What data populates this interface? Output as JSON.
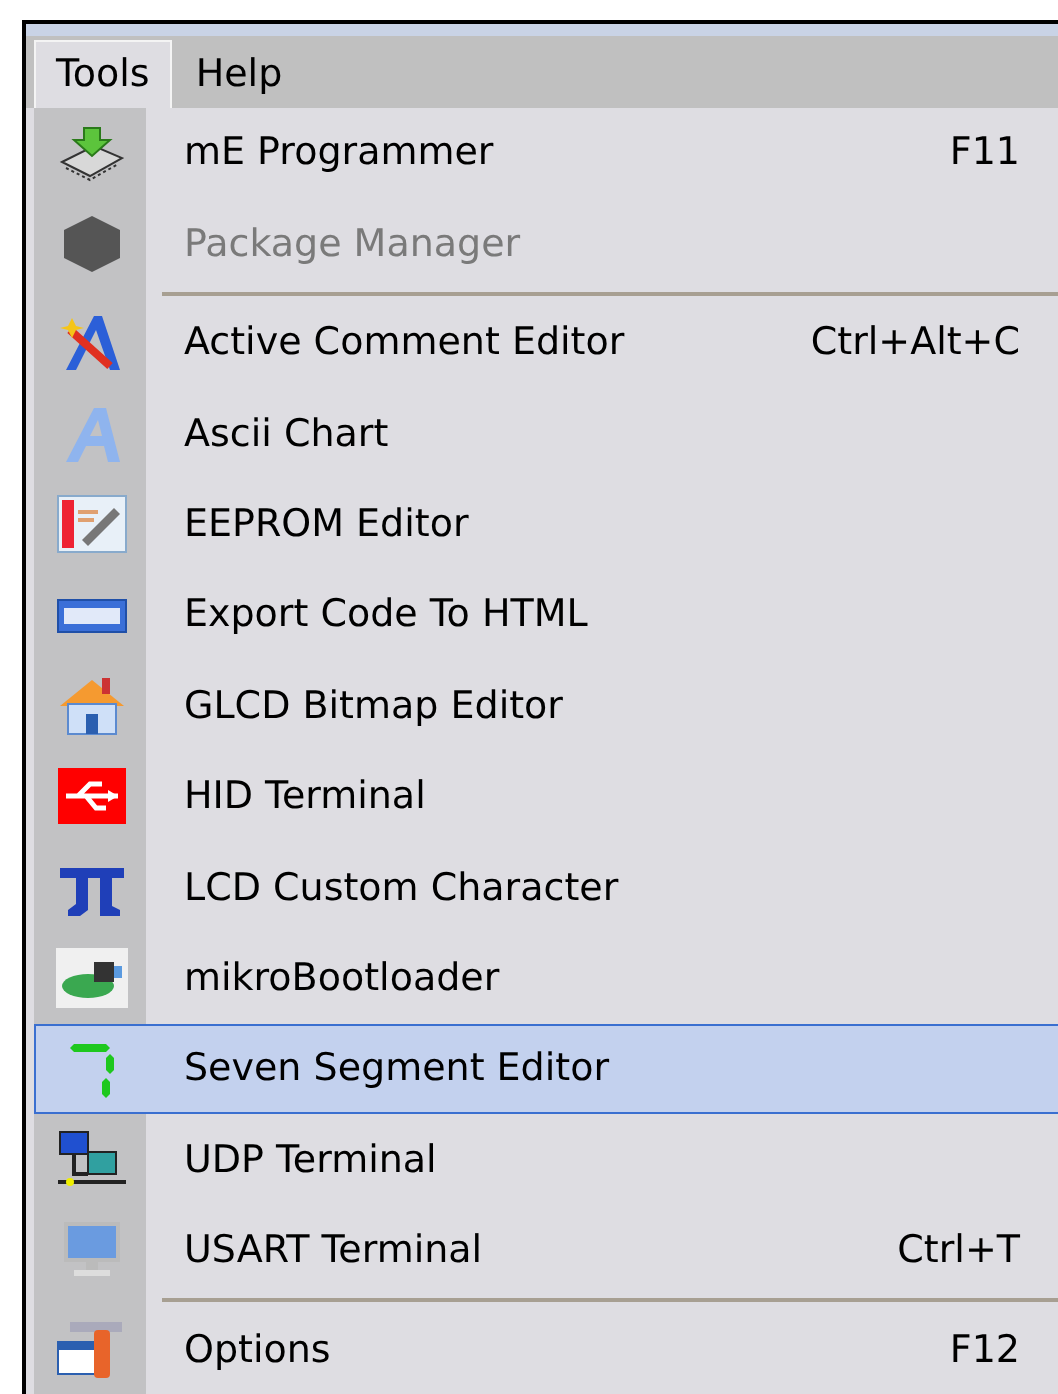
{
  "menu_bar": [
    {
      "label": "Tools",
      "selected": true
    },
    {
      "label": "Help",
      "selected": false
    }
  ],
  "menu_items": [
    {
      "kind": "command",
      "label": "mE Programmer",
      "shortcut": "F11",
      "disabled": false,
      "selected": false
    },
    {
      "kind": "command",
      "label": "Package Manager",
      "disabled": true,
      "selected": false
    },
    {
      "kind": "separator"
    },
    {
      "kind": "command",
      "label": "Active Comment Editor",
      "shortcut": "Ctrl+Alt+C",
      "disabled": false,
      "selected": false
    },
    {
      "kind": "command",
      "label": "Ascii Chart",
      "disabled": false,
      "selected": false
    },
    {
      "kind": "command",
      "label": "EEPROM Editor",
      "disabled": false,
      "selected": false
    },
    {
      "kind": "command",
      "label": "Export Code To HTML",
      "disabled": false,
      "selected": false
    },
    {
      "kind": "command",
      "label": "GLCD Bitmap Editor",
      "disabled": false,
      "selected": false
    },
    {
      "kind": "command",
      "label": "HID Terminal",
      "disabled": false,
      "selected": false
    },
    {
      "kind": "command",
      "label": "LCD Custom Character",
      "disabled": false,
      "selected": false
    },
    {
      "kind": "command",
      "label": "mikroBootloader",
      "disabled": false,
      "selected": false
    },
    {
      "kind": "command",
      "label": "Seven Segment Editor",
      "disabled": false,
      "selected": true
    },
    {
      "kind": "command",
      "label": "UDP Terminal",
      "disabled": false,
      "selected": false
    },
    {
      "kind": "command",
      "label": "USART Terminal",
      "shortcut": "Ctrl+T",
      "disabled": false,
      "selected": false
    },
    {
      "kind": "separator"
    },
    {
      "kind": "command",
      "label": "Options",
      "shortcut": "F12",
      "disabled": false,
      "selected": false
    }
  ]
}
